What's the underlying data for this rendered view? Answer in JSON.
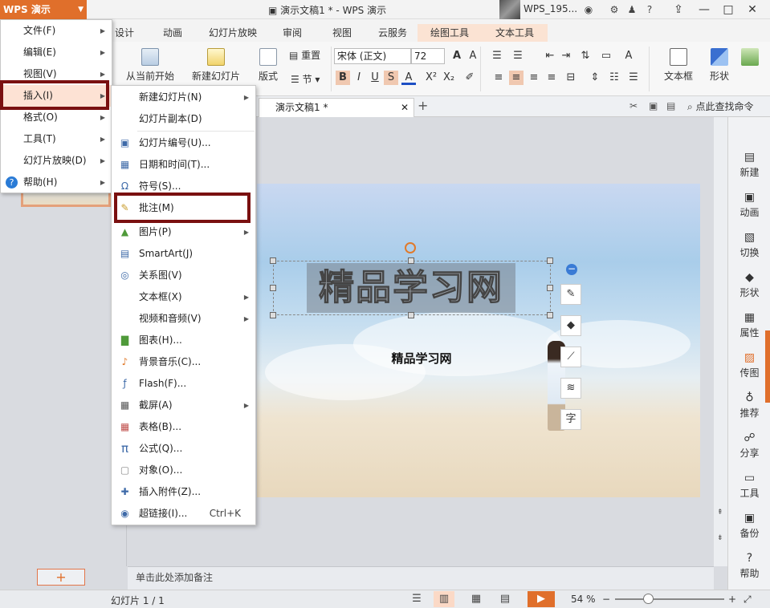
{
  "titlebar": {
    "app_name": "WPS 演示",
    "doc_title": "演示文稿1 * - WPS 演示",
    "username": "WPS_195...",
    "icons": [
      "settings-icon",
      "shirt-icon",
      "help-icon",
      "dropdown-icon"
    ],
    "window_controls": [
      "restore-icon",
      "minimize-icon",
      "maximize-icon",
      "close-icon"
    ]
  },
  "ribbon_tabs": [
    {
      "label": "设计"
    },
    {
      "label": "动画"
    },
    {
      "label": "幻灯片放映"
    },
    {
      "label": "审阅"
    },
    {
      "label": "视图"
    },
    {
      "label": "云服务"
    },
    {
      "label": "绘图工具",
      "context": true
    },
    {
      "label": "文本工具",
      "context": true
    }
  ],
  "ribbon": {
    "from_current": "从当前开始",
    "new_slide": "新建幻灯片",
    "layout": "版式",
    "reset": "重置",
    "section": "节",
    "font_name": "宋体 (正文)",
    "font_size": "72",
    "textbox": "文本框",
    "shape": "形状",
    "search": "点此查找命令"
  },
  "doc_tab": {
    "label": "演示文稿1 *"
  },
  "main_menu": {
    "items": [
      {
        "label": "文件(F)",
        "sub": true
      },
      {
        "label": "编辑(E)",
        "sub": true
      },
      {
        "label": "视图(V)",
        "sub": true
      },
      {
        "label": "插入(I)",
        "sub": true,
        "highlighted": true
      },
      {
        "label": "格式(O)",
        "sub": true
      },
      {
        "label": "工具(T)",
        "sub": true
      },
      {
        "label": "幻灯片放映(D)",
        "sub": true
      },
      {
        "label": "帮助(H)",
        "sub": true
      }
    ]
  },
  "insert_menu": {
    "items": [
      {
        "label": "新建幻灯片(N)",
        "sub": true,
        "icon": ""
      },
      {
        "label": "幻灯片副本(D)",
        "sub": false,
        "icon": ""
      },
      {
        "label": "幻灯片编号(U)...",
        "icon": "▣"
      },
      {
        "label": "日期和时间(T)...",
        "icon": "▦"
      },
      {
        "label": "符号(S)...",
        "icon": "Ω"
      },
      {
        "label": "批注(M)",
        "icon": "✎",
        "highlighted": true
      },
      {
        "label": "图片(P)",
        "sub": true,
        "icon": "▲"
      },
      {
        "label": "SmartArt(J)",
        "icon": "▤"
      },
      {
        "label": "关系图(V)",
        "icon": "◎"
      },
      {
        "label": "文本框(X)",
        "sub": true,
        "icon": ""
      },
      {
        "label": "视频和音频(V)",
        "sub": true,
        "icon": ""
      },
      {
        "label": "图表(H)...",
        "icon": "▇"
      },
      {
        "label": "背景音乐(C)...",
        "icon": "♪"
      },
      {
        "label": "Flash(F)...",
        "icon": "ƒ"
      },
      {
        "label": "截屏(A)",
        "sub": true,
        "icon": "▦"
      },
      {
        "label": "表格(B)...",
        "icon": "▦"
      },
      {
        "label": "公式(Q)...",
        "icon": "π"
      },
      {
        "label": "对象(O)...",
        "icon": "▢"
      },
      {
        "label": "插入附件(Z)...",
        "icon": "✚"
      },
      {
        "label": "超链接(I)...",
        "icon": "◉",
        "shortcut": "Ctrl+K"
      }
    ]
  },
  "slide": {
    "title_text": "精品学习网",
    "subtitle_text": "精品学习网"
  },
  "notes_placeholder": "单击此处添加备注",
  "right_panel": [
    {
      "label": "新建",
      "icon": "new-icon"
    },
    {
      "label": "动画",
      "icon": "animation-icon"
    },
    {
      "label": "切换",
      "icon": "transition-icon"
    },
    {
      "label": "形状",
      "icon": "shape-icon"
    },
    {
      "label": "属性",
      "icon": "properties-icon"
    },
    {
      "label": "传图",
      "icon": "upload-image-icon"
    },
    {
      "label": "推荐",
      "icon": "recommend-icon"
    },
    {
      "label": "分享",
      "icon": "share-icon"
    },
    {
      "label": "工具",
      "icon": "tools-icon"
    },
    {
      "label": "备份",
      "icon": "backup-icon"
    },
    {
      "label": "帮助",
      "icon": "help-icon"
    }
  ],
  "statusbar": {
    "slide_info": "幻灯片 1 / 1",
    "zoom": "54 %",
    "zoom_level": 0.54
  }
}
